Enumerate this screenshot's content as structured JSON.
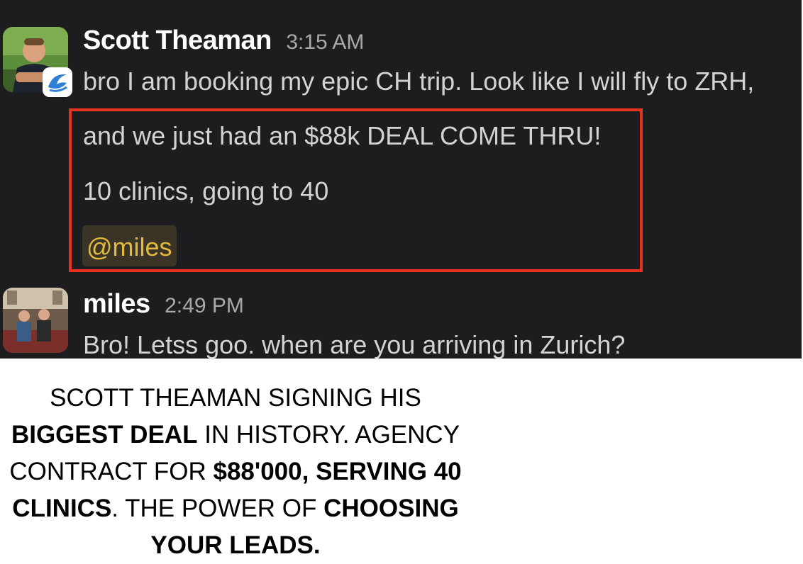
{
  "messages": [
    {
      "author": "Scott Theaman",
      "time": "3:15 AM",
      "lines": [
        "bro I am booking my epic CH trip. Look like I will fly to ZRH,",
        "and we just had an $88k DEAL COME THRU!",
        "10 clinics, going to 40"
      ],
      "mention": "@miles"
    },
    {
      "author": "miles",
      "time": "2:49 PM",
      "lines": [
        "Bro! Letss goo. when are you arriving in Zurich?"
      ]
    }
  ],
  "colors": {
    "background": "#1d1c1f",
    "highlight_border": "#e8321f",
    "mention_text": "#e3b93e",
    "mention_bg": "#3a3426"
  },
  "icons": {
    "author_badge": "app-badge-icon"
  },
  "caption": {
    "p1": "SCOTT THEAMAN SIGNING HIS",
    "p2_bold": "BIGGEST DEAL",
    "p3": " IN HISTORY. AGENCY CONTRACT FOR ",
    "p4_bold": "$88'000, SERVING 40 CLINICS",
    "p5": ". THE POWER OF ",
    "p6_bold": "CHOOSING YOUR LEADS."
  }
}
